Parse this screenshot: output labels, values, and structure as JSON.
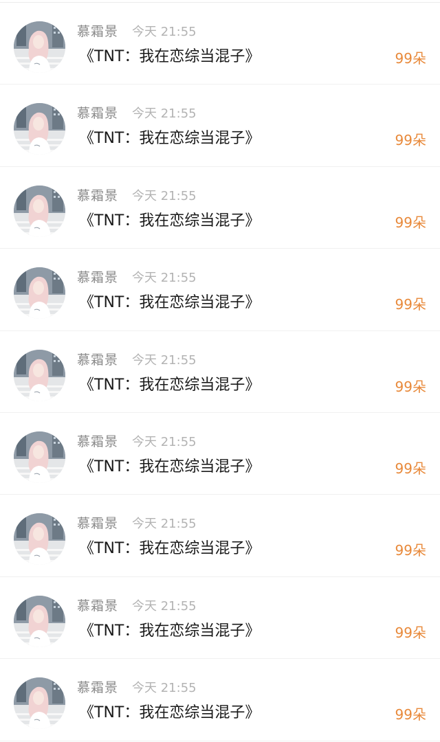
{
  "feed": {
    "items": [
      {
        "user": "慕霜景",
        "time": "今天 21:55",
        "gift": "《TNT：我在恋综当混子》",
        "count": "99朵"
      },
      {
        "user": "慕霜景",
        "time": "今天 21:55",
        "gift": "《TNT：我在恋综当混子》",
        "count": "99朵"
      },
      {
        "user": "慕霜景",
        "time": "今天 21:55",
        "gift": "《TNT：我在恋综当混子》",
        "count": "99朵"
      },
      {
        "user": "慕霜景",
        "time": "今天 21:55",
        "gift": "《TNT：我在恋综当混子》",
        "count": "99朵"
      },
      {
        "user": "慕霜景",
        "time": "今天 21:55",
        "gift": "《TNT：我在恋综当混子》",
        "count": "99朵"
      },
      {
        "user": "慕霜景",
        "time": "今天 21:55",
        "gift": "《TNT：我在恋综当混子》",
        "count": "99朵"
      },
      {
        "user": "慕霜景",
        "time": "今天 21:55",
        "gift": "《TNT：我在恋综当混子》",
        "count": "99朵"
      },
      {
        "user": "慕霜景",
        "time": "今天 21:55",
        "gift": "《TNT：我在恋综当混子》",
        "count": "99朵"
      },
      {
        "user": "慕霜景",
        "time": "今天 21:55",
        "gift": "《TNT：我在恋综当混子》",
        "count": "99朵"
      }
    ]
  },
  "colors": {
    "count": "#e8893a",
    "name": "#8a8a8a",
    "time": "#b3b3b3",
    "title": "#1a1a1a"
  }
}
